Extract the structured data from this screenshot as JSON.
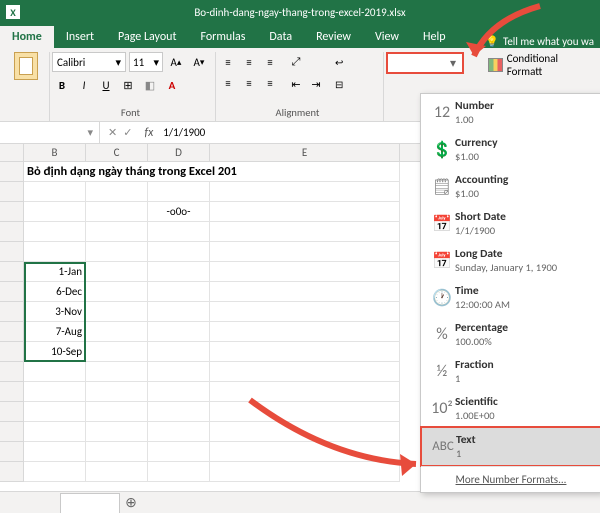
{
  "title": "Bo-dinh-dang-ngay-thang-trong-excel-2019.xlsx",
  "tabs": [
    "Home",
    "Insert",
    "Page Layout",
    "Formulas",
    "Data",
    "Review",
    "View",
    "Help"
  ],
  "tellme": "Tell me what you wa",
  "ribbon": {
    "paste_label": "Paste",
    "font_name": "Calibri",
    "font_size": "11",
    "font_group": "Font",
    "align_group": "Alignment",
    "number_group": "",
    "wrap": "Wrap Text",
    "merge": "Merge & Center",
    "condfmt": "Conditional Formatt",
    "numfmt_value": ""
  },
  "namebox": "",
  "formula": "1/1/1900",
  "columns": [
    "B",
    "C",
    "D",
    "E"
  ],
  "sheet": {
    "title_row": "Bỏ định dạng ngày tháng trong Excel 201",
    "ooo": "-o0o-",
    "b6": "1-Jan",
    "b7": "6-Dec",
    "b8": "3-Nov",
    "b9": "7-Aug",
    "b10": "10-Sep"
  },
  "dropdown": {
    "number": {
      "label": "Number",
      "sample": "1.00"
    },
    "currency": {
      "label": "Currency",
      "sample": "$1.00"
    },
    "accounting": {
      "label": "Accounting",
      "sample": "$1.00"
    },
    "shortdate": {
      "label": "Short Date",
      "sample": "1/1/1900"
    },
    "longdate": {
      "label": "Long Date",
      "sample": "Sunday, January 1, 1900"
    },
    "time": {
      "label": "Time",
      "sample": "12:00:00 AM"
    },
    "percentage": {
      "label": "Percentage",
      "sample": "100.00%"
    },
    "fraction": {
      "label": "Fraction",
      "sample": "1"
    },
    "scientific": {
      "label": "Scientific",
      "sample": "1.00E+00"
    },
    "text": {
      "label": "Text",
      "sample": "1"
    },
    "more": "More Number Formats..."
  }
}
